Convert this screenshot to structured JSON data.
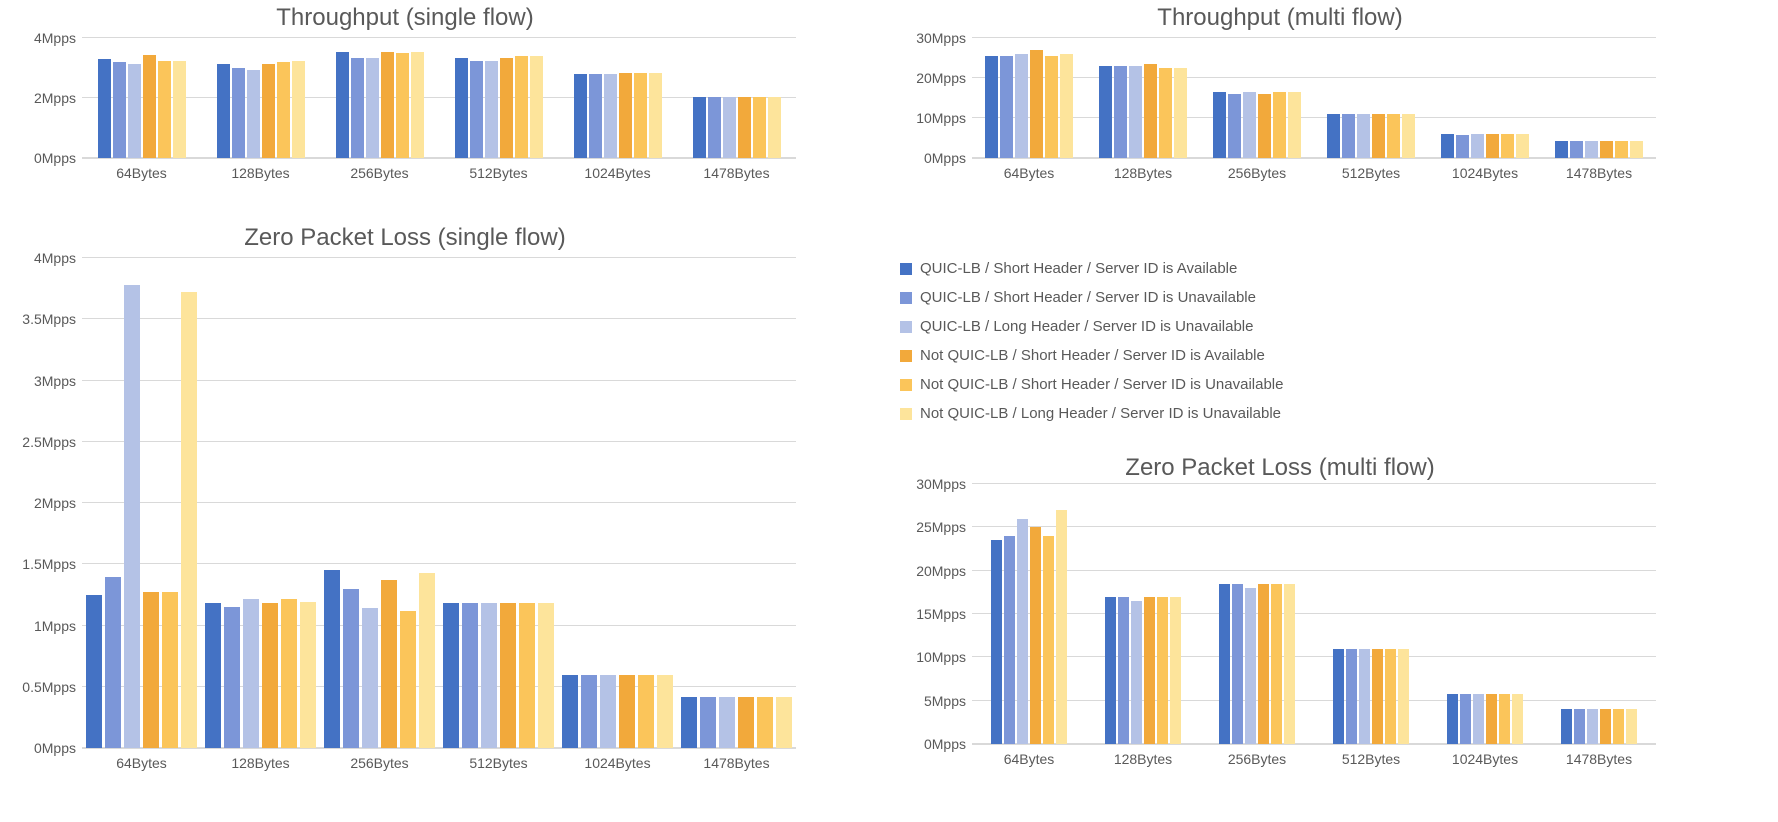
{
  "series_colors": [
    "#4472C4",
    "#7C96D8",
    "#B4C2E6",
    "#F2A93B",
    "#FBC55A",
    "#FDE49B"
  ],
  "legend": [
    "QUIC-LB / Short Header / Server ID is Available",
    "QUIC-LB / Short Header / Server ID is Unavailable",
    "QUIC-LB / Long Header / Server ID is Unavailable",
    "Not QUIC-LB / Short Header / Server ID is Available",
    "Not QUIC-LB / Short Header / Server ID is Unavailable",
    "Not QUIC-LB / Long Header / Server ID is Unavailable"
  ],
  "chart_data": [
    {
      "id": "tp_single",
      "type": "bar",
      "title": "Throughput (single flow)",
      "xlabel": "",
      "ylabel": "",
      "ylim": [
        0,
        4
      ],
      "yunit": "Mpps",
      "yticks": [
        0,
        2,
        4
      ],
      "categories": [
        "64Bytes",
        "128Bytes",
        "256Bytes",
        "512Bytes",
        "1024Bytes",
        "1478Bytes"
      ],
      "series": [
        {
          "name": "QUIC-LB / Short Header / Server ID is Available",
          "values": [
            3.3,
            3.15,
            3.55,
            3.35,
            2.8,
            2.05
          ]
        },
        {
          "name": "QUIC-LB / Short Header / Server ID is Unavailable",
          "values": [
            3.2,
            3.0,
            3.35,
            3.25,
            2.8,
            2.05
          ]
        },
        {
          "name": "QUIC-LB / Long Header / Server ID is Unavailable",
          "values": [
            3.15,
            2.95,
            3.35,
            3.25,
            2.8,
            2.05
          ]
        },
        {
          "name": "Not QUIC-LB / Short Header / Server ID is Available",
          "values": [
            3.45,
            3.15,
            3.55,
            3.35,
            2.85,
            2.05
          ]
        },
        {
          "name": "Not QUIC-LB / Short Header / Server ID is Unavailable",
          "values": [
            3.25,
            3.2,
            3.5,
            3.4,
            2.85,
            2.05
          ]
        },
        {
          "name": "Not QUIC-LB / Long Header / Server ID is Unavailable",
          "values": [
            3.25,
            3.25,
            3.55,
            3.4,
            2.85,
            2.05
          ]
        }
      ]
    },
    {
      "id": "tp_multi",
      "type": "bar",
      "title": "Throughput (multi flow)",
      "xlabel": "",
      "ylabel": "",
      "ylim": [
        0,
        30
      ],
      "yunit": "Mpps",
      "yticks": [
        0,
        10,
        20,
        30
      ],
      "categories": [
        "64Bytes",
        "128Bytes",
        "256Bytes",
        "512Bytes",
        "1024Bytes",
        "1478Bytes"
      ],
      "series": [
        {
          "name": "QUIC-LB / Short Header / Server ID is Available",
          "values": [
            25.5,
            23.0,
            16.5,
            11.0,
            6.0,
            4.2
          ]
        },
        {
          "name": "QUIC-LB / Short Header / Server ID is Unavailable",
          "values": [
            25.5,
            23.0,
            16.0,
            11.0,
            5.8,
            4.2
          ]
        },
        {
          "name": "QUIC-LB / Long Header / Server ID is Unavailable",
          "values": [
            26.0,
            23.0,
            16.5,
            11.0,
            6.0,
            4.2
          ]
        },
        {
          "name": "Not QUIC-LB / Short Header / Server ID is Available",
          "values": [
            27.0,
            23.5,
            16.0,
            11.0,
            6.0,
            4.2
          ]
        },
        {
          "name": "Not QUIC-LB / Short Header / Server ID is Unavailable",
          "values": [
            25.5,
            22.5,
            16.5,
            11.0,
            6.0,
            4.2
          ]
        },
        {
          "name": "Not QUIC-LB / Long Header / Server ID is Unavailable",
          "values": [
            26.0,
            22.5,
            16.5,
            11.0,
            6.0,
            4.2
          ]
        }
      ]
    },
    {
      "id": "zpl_single",
      "type": "bar",
      "title": "Zero Packet Loss (single flow)",
      "xlabel": "",
      "ylabel": "",
      "ylim": [
        0,
        4
      ],
      "yunit": "Mpps",
      "yticks": [
        0,
        0.5,
        1,
        1.5,
        2,
        2.5,
        3,
        3.5,
        4
      ],
      "categories": [
        "64Bytes",
        "128Bytes",
        "256Bytes",
        "512Bytes",
        "1024Bytes",
        "1478Bytes"
      ],
      "series": [
        {
          "name": "QUIC-LB / Short Header / Server ID is Available",
          "values": [
            1.25,
            1.18,
            1.45,
            1.18,
            0.6,
            0.42
          ]
        },
        {
          "name": "QUIC-LB / Short Header / Server ID is Unavailable",
          "values": [
            1.4,
            1.15,
            1.3,
            1.18,
            0.6,
            0.42
          ]
        },
        {
          "name": "QUIC-LB / Long Header / Server ID is Unavailable",
          "values": [
            3.78,
            1.22,
            1.14,
            1.18,
            0.6,
            0.42
          ]
        },
        {
          "name": "Not QUIC-LB / Short Header / Server ID is Available",
          "values": [
            1.27,
            1.18,
            1.37,
            1.18,
            0.6,
            0.42
          ]
        },
        {
          "name": "Not QUIC-LB / Short Header / Server ID is Unavailable",
          "values": [
            1.27,
            1.22,
            1.12,
            1.18,
            0.6,
            0.42
          ]
        },
        {
          "name": "Not QUIC-LB / Long Header / Server ID is Unavailable",
          "values": [
            3.72,
            1.19,
            1.43,
            1.18,
            0.6,
            0.42
          ]
        }
      ]
    },
    {
      "id": "zpl_multi",
      "type": "bar",
      "title": "Zero Packet Loss (multi flow)",
      "xlabel": "",
      "ylabel": "",
      "ylim": [
        0,
        30
      ],
      "yunit": "Mpps",
      "yticks": [
        0,
        5,
        10,
        15,
        20,
        25,
        30
      ],
      "categories": [
        "64Bytes",
        "128Bytes",
        "256Bytes",
        "512Bytes",
        "1024Bytes",
        "1478Bytes"
      ],
      "series": [
        {
          "name": "QUIC-LB / Short Header / Server ID is Available",
          "values": [
            23.5,
            17.0,
            18.5,
            11.0,
            5.8,
            4.0
          ]
        },
        {
          "name": "QUIC-LB / Short Header / Server ID is Unavailable",
          "values": [
            24.0,
            17.0,
            18.5,
            11.0,
            5.8,
            4.0
          ]
        },
        {
          "name": "QUIC-LB / Long Header / Server ID is Unavailable",
          "values": [
            26.0,
            16.5,
            18.0,
            11.0,
            5.8,
            4.0
          ]
        },
        {
          "name": "Not QUIC-LB / Short Header / Server ID is Available",
          "values": [
            25.0,
            17.0,
            18.5,
            11.0,
            5.8,
            4.0
          ]
        },
        {
          "name": "Not QUIC-LB / Short Header / Server ID is Unavailable",
          "values": [
            24.0,
            17.0,
            18.5,
            11.0,
            5.8,
            4.0
          ]
        },
        {
          "name": "Not QUIC-LB / Long Header / Server ID is Unavailable",
          "values": [
            27.0,
            17.0,
            18.5,
            11.0,
            5.8,
            4.0
          ]
        }
      ]
    }
  ]
}
